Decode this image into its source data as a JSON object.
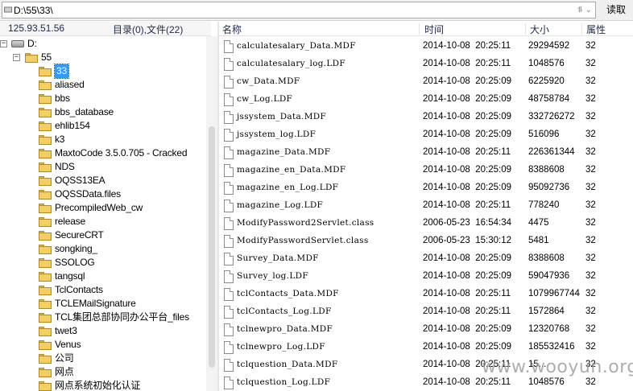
{
  "address_bar": {
    "path": "D:\\55\\33\\",
    "read_button": "读取"
  },
  "info_bar": {
    "ip": "125.93.51.56",
    "counts": "目录(0),文件(22)"
  },
  "tree": {
    "drive": "D:",
    "parent": "55",
    "folders": [
      "33",
      "aliased",
      "bbs",
      "bbs_database",
      "ehlib154",
      "k3",
      "MaxtoCode 3.5.0.705 - Cracked",
      "NDS",
      "OQSS13EA",
      "OQSSData.files",
      "PrecompiledWeb_cw",
      "release",
      "SecureCRT",
      "songking_",
      "SSOLOG",
      "tangsql",
      "TclContacts",
      "TCLEMailSignature",
      "TCL集团总部协同办公平台_files",
      "twet3",
      "Venus",
      "公司",
      "网点",
      "网点系统初始化认证"
    ],
    "selected": "33"
  },
  "file_list": {
    "columns": {
      "name": "名称",
      "time": "时间",
      "size": "大小",
      "attr": "属性"
    },
    "rows": [
      {
        "name": "calculatesalary_Data.MDF",
        "time": "2014-10-08  20:25:11",
        "size": "29294592",
        "attr": "32"
      },
      {
        "name": "calculatesalary_log.LDF",
        "time": "2014-10-08  20:25:11",
        "size": "1048576",
        "attr": "32"
      },
      {
        "name": "cw_Data.MDF",
        "time": "2014-10-08  20:25:09",
        "size": "6225920",
        "attr": "32"
      },
      {
        "name": "cw_Log.LDF",
        "time": "2014-10-08  20:25:09",
        "size": "48758784",
        "attr": "32"
      },
      {
        "name": "jssystem_Data.MDF",
        "time": "2014-10-08  20:25:09",
        "size": "332726272",
        "attr": "32"
      },
      {
        "name": "jssystem_log.LDF",
        "time": "2014-10-08  20:25:09",
        "size": "516096",
        "attr": "32"
      },
      {
        "name": "magazine_Data.MDF",
        "time": "2014-10-08  20:25:11",
        "size": "226361344",
        "attr": "32"
      },
      {
        "name": "magazine_en_Data.MDF",
        "time": "2014-10-08  20:25:09",
        "size": "8388608",
        "attr": "32"
      },
      {
        "name": "magazine_en_Log.LDF",
        "time": "2014-10-08  20:25:09",
        "size": "95092736",
        "attr": "32"
      },
      {
        "name": "magazine_Log.LDF",
        "time": "2014-10-08  20:25:11",
        "size": "778240",
        "attr": "32"
      },
      {
        "name": "ModifyPassword2Servlet.class",
        "time": "2006-05-23  16:54:34",
        "size": "4475",
        "attr": "32"
      },
      {
        "name": "ModifyPasswordServlet.class",
        "time": "2006-05-23  15:30:12",
        "size": "5481",
        "attr": "32"
      },
      {
        "name": "Survey_Data.MDF",
        "time": "2014-10-08  20:25:09",
        "size": "8388608",
        "attr": "32"
      },
      {
        "name": "Survey_log.LDF",
        "time": "2014-10-08  20:25:09",
        "size": "59047936",
        "attr": "32"
      },
      {
        "name": "tclContacts_Data.MDF",
        "time": "2014-10-08  20:25:11",
        "size": "1079967744",
        "attr": "32"
      },
      {
        "name": "tclContacts_Log.LDF",
        "time": "2014-10-08  20:25:11",
        "size": "1572864",
        "attr": "32"
      },
      {
        "name": "tclnewpro_Data.MDF",
        "time": "2014-10-08  20:25:09",
        "size": "12320768",
        "attr": "32"
      },
      {
        "name": "tclnewpro_Log.LDF",
        "time": "2014-10-08  20:25:09",
        "size": "185532416",
        "attr": "32"
      },
      {
        "name": "tclquestion_Data.MDF",
        "time": "2014-10-08  20:25:11",
        "size": "15...",
        "attr": "32"
      },
      {
        "name": "tclquestion_Log.LDF",
        "time": "2014-10-08  20:25:11",
        "size": "1048576",
        "attr": "32"
      }
    ]
  },
  "watermark": "www.wooyun.org"
}
